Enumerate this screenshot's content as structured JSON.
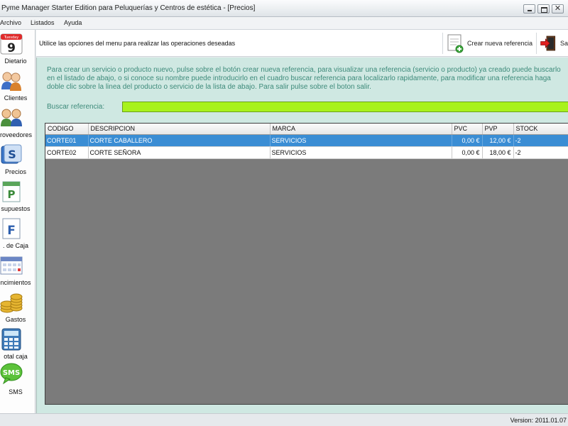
{
  "window": {
    "title": "Pyme Manager Starter Edition para Peluquerías y Centros de estética - [Precios]",
    "close_glyph": "✕"
  },
  "menu": [
    "Archivo",
    "Listados",
    "Ayuda"
  ],
  "sidebar": {
    "calendar_day": "9",
    "calendar_weekday": "Tuesday",
    "sms_icon_text": "SMS",
    "items": [
      {
        "label": "Dietario",
        "icon": "calendar-icon"
      },
      {
        "label": "Clientes",
        "icon": "clients-icon"
      },
      {
        "label": "roveedores",
        "icon": "suppliers-icon"
      },
      {
        "label": "Precios",
        "icon": "prices-icon"
      },
      {
        "label": "supuestos",
        "icon": "budgets-icon"
      },
      {
        "label": ". de Caja",
        "icon": "cash-icon"
      },
      {
        "label": "ncimientos",
        "icon": "due-dates-icon"
      },
      {
        "label": "Gastos",
        "icon": "coins-icon"
      },
      {
        "label": "otal caja",
        "icon": "calculator-icon"
      },
      {
        "label": "SMS",
        "icon": "sms-icon"
      }
    ]
  },
  "toolbar": {
    "hint": "Utilice las opciones del menu para realizar las operaciones deseadas",
    "new_ref_label": "Crear nueva referencia",
    "exit_label": "Sa"
  },
  "panel": {
    "description": "Para crear un servicio o producto nuevo, pulse sobre el botón crear nueva referencia, para visualizar una referencia (servicio o producto) ya creado puede buscarlo en el listado de abajo, o si conoce su nombre puede introducirlo en el cuadro buscar referencia para localizarlo rapidamente, para modificar una referencia haga doble clic sobre la linea del producto o servicio de la lista de abajo. Para salir pulse sobre el boton salir.",
    "search_label": "Buscar referencia:",
    "search_value": ""
  },
  "grid": {
    "columns": [
      "CODIGO",
      "DESCRIPCION",
      "MARCA",
      "PVC",
      "PVP",
      "STOCK"
    ],
    "rows": [
      {
        "codigo": "CORTE01",
        "descripcion": "CORTE CABALLERO",
        "marca": "SERVICIOS",
        "pvc": "0,00 €",
        "pvp": "12,00 €",
        "stock": "-2",
        "selected": true
      },
      {
        "codigo": "CORTE02",
        "descripcion": "CORTE SEÑORA",
        "marca": "SERVICIOS",
        "pvc": "0,00 €",
        "pvp": "18,00 €",
        "stock": "-2",
        "selected": false
      }
    ]
  },
  "status": {
    "version": "Version: 2011.01.07"
  },
  "colors": {
    "accent_selection": "#3a8dd4",
    "panel_bg": "#cfe8e2",
    "panel_text": "#3d8a7a",
    "search_bg": "#a8f21c",
    "grid_bg": "#7b7b7b"
  }
}
